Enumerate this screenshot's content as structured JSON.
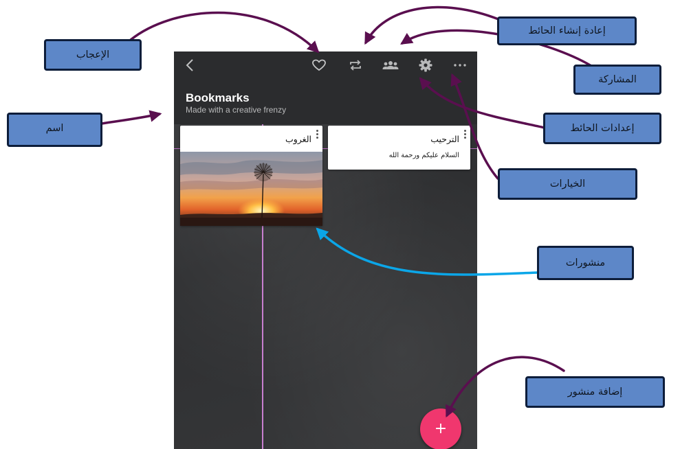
{
  "wall": {
    "title": "Bookmarks",
    "subtitle": "Made with a creative frenzy"
  },
  "toolbar": {
    "icons": [
      "back-icon",
      "heart-icon",
      "repost-icon",
      "people-icon",
      "gear-icon",
      "more-icon"
    ]
  },
  "posts": [
    {
      "title": "الترحيب",
      "body": "السلام عليكم ورحمة الله"
    },
    {
      "title": "الغروب",
      "image": "dandelion-sunset"
    }
  ],
  "fab": {
    "label": "+"
  },
  "callouts": {
    "like": "الإعجاب",
    "remake": "إعادة إنشاء الحائط",
    "share": "المشاركة",
    "name": "اسم",
    "settings": "إعدادات الحائط",
    "options": "الخيارات",
    "posts": "منشورات",
    "add_post": "إضافة منشور"
  },
  "colors": {
    "callout_bg": "#5d87c8",
    "callout_border": "#0d1d3a",
    "arrow_purple": "#5a0f4f",
    "arrow_blue": "#0ba6e8",
    "fab": "#f0376e",
    "topbar": "#2b2c2e"
  }
}
